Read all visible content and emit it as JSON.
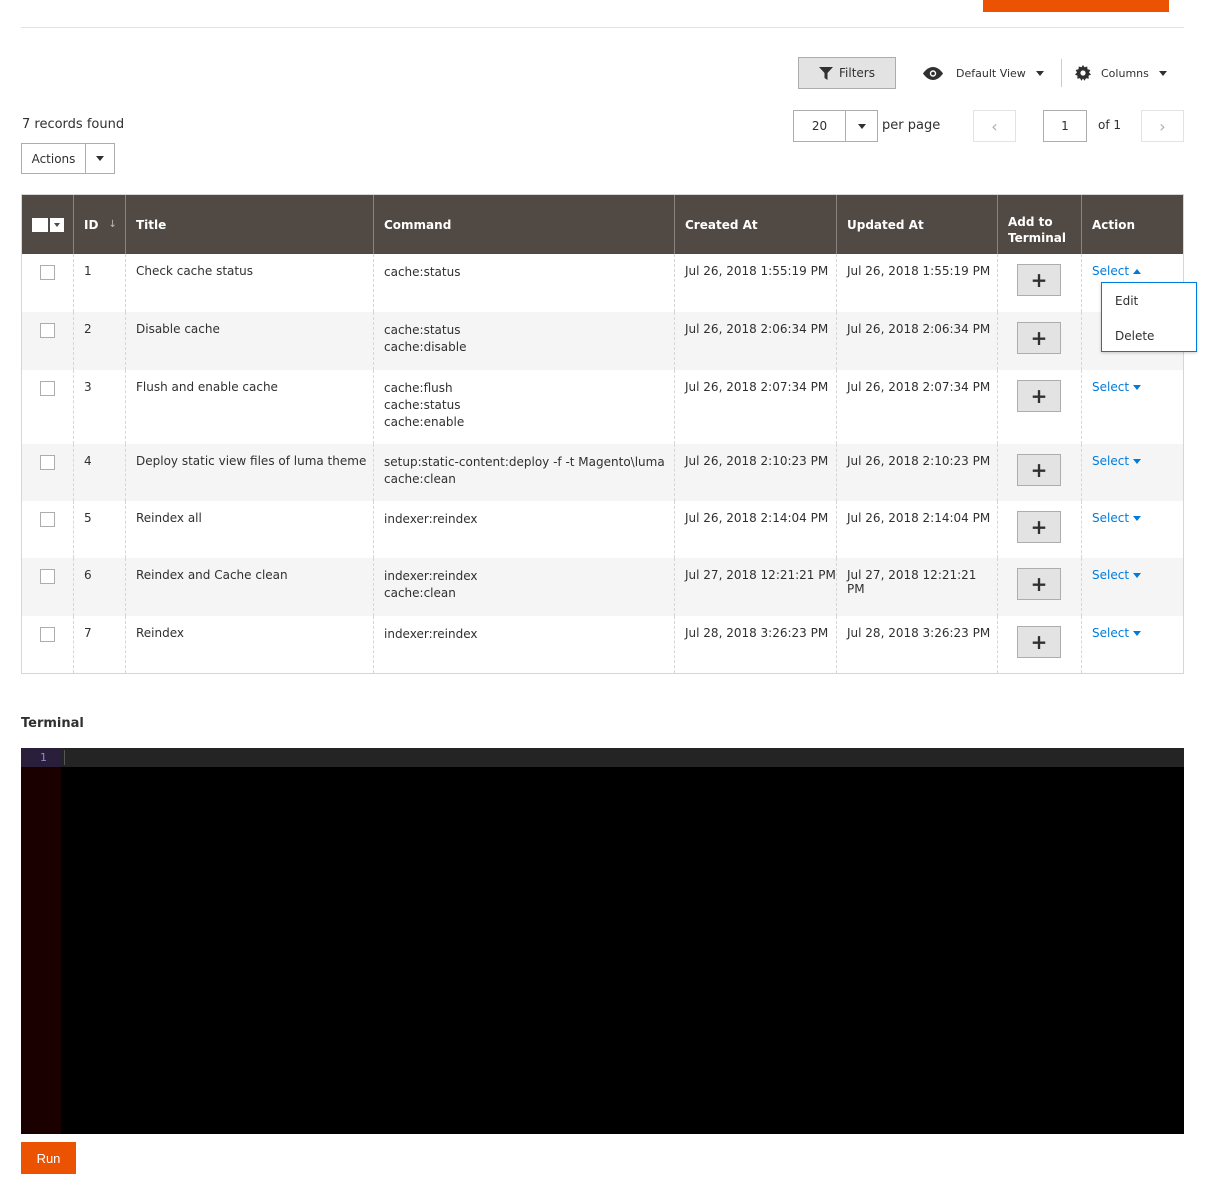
{
  "toolbar": {
    "filters_label": "Filters",
    "view_label": "Default View",
    "columns_label": "Columns"
  },
  "grid_info": {
    "records_found": "7 records found",
    "actions_label": "Actions",
    "per_page_value": "20",
    "per_page_label": "per page",
    "current_page": "1",
    "total_pages_label": "of 1"
  },
  "columns": {
    "id": "ID",
    "title": "Title",
    "command": "Command",
    "created_at": "Created At",
    "updated_at": "Updated At",
    "add_to_terminal": "Add to Terminal",
    "action": "Action"
  },
  "rows": [
    {
      "id": "1",
      "title": "Check cache status",
      "command": [
        "cache:status"
      ],
      "created": "Jul 26, 2018 1:55:19 PM",
      "updated": "Jul 26, 2018 1:55:19 PM",
      "action": "Select"
    },
    {
      "id": "2",
      "title": "Disable cache",
      "command": [
        "cache:status",
        "cache:disable"
      ],
      "created": "Jul 26, 2018 2:06:34 PM",
      "updated": "Jul 26, 2018 2:06:34 PM",
      "action": "Select"
    },
    {
      "id": "3",
      "title": "Flush and enable cache",
      "command": [
        "cache:flush",
        "cache:status",
        "cache:enable"
      ],
      "created": "Jul 26, 2018 2:07:34 PM",
      "updated": "Jul 26, 2018 2:07:34 PM",
      "action": "Select"
    },
    {
      "id": "4",
      "title": "Deploy static view files of luma theme",
      "command": [
        "setup:static-content:deploy -f -t Magento\\luma",
        "cache:clean"
      ],
      "created": "Jul 26, 2018 2:10:23 PM",
      "updated": "Jul 26, 2018 2:10:23 PM",
      "action": "Select"
    },
    {
      "id": "5",
      "title": "Reindex all",
      "command": [
        "indexer:reindex"
      ],
      "created": "Jul 26, 2018 2:14:04 PM",
      "updated": "Jul 26, 2018 2:14:04 PM",
      "action": "Select"
    },
    {
      "id": "6",
      "title": "Reindex and Cache clean",
      "command": [
        "indexer:reindex",
        "cache:clean"
      ],
      "created": "Jul 27, 2018 12:21:21 PM",
      "updated": "Jul 27, 2018 12:21:21 PM",
      "action": "Select"
    },
    {
      "id": "7",
      "title": "Reindex",
      "command": [
        "indexer:reindex"
      ],
      "created": "Jul 28, 2018 3:26:23 PM",
      "updated": "Jul 28, 2018 3:26:23 PM",
      "action": "Select"
    }
  ],
  "action_menu": {
    "edit": "Edit",
    "delete": "Delete"
  },
  "terminal": {
    "title": "Terminal",
    "line_number": "1",
    "run_label": "Run"
  },
  "icons": {
    "filters": "filter-icon",
    "view": "eye-icon",
    "columns": "gear-icon",
    "add": "plus-icon"
  },
  "colors": {
    "accent": "#eb5202",
    "header_bg": "#514943",
    "link": "#007bdb"
  }
}
